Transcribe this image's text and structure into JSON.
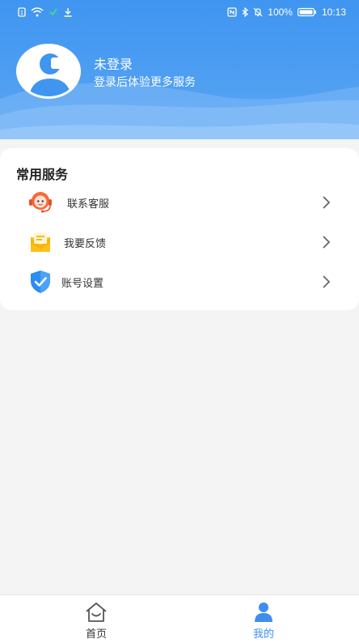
{
  "status_bar": {
    "battery": "100%",
    "time": "10:13"
  },
  "profile": {
    "title": "未登录",
    "subtitle": "登录后体验更多服务"
  },
  "services": {
    "title": "常用服务",
    "items": [
      {
        "label": "联系客服",
        "icon": "customer-service-icon"
      },
      {
        "label": "我要反馈",
        "icon": "feedback-icon"
      },
      {
        "label": "账号设置",
        "icon": "shield-check-icon"
      }
    ]
  },
  "tabbar": {
    "tabs": [
      {
        "label": "首页",
        "icon": "home-icon",
        "active": false
      },
      {
        "label": "我的",
        "icon": "user-icon",
        "active": true
      }
    ]
  },
  "colors": {
    "header_blue": "#3f95f0",
    "active_tab": "#3d8ef0",
    "inactive_tab": "#666666"
  }
}
